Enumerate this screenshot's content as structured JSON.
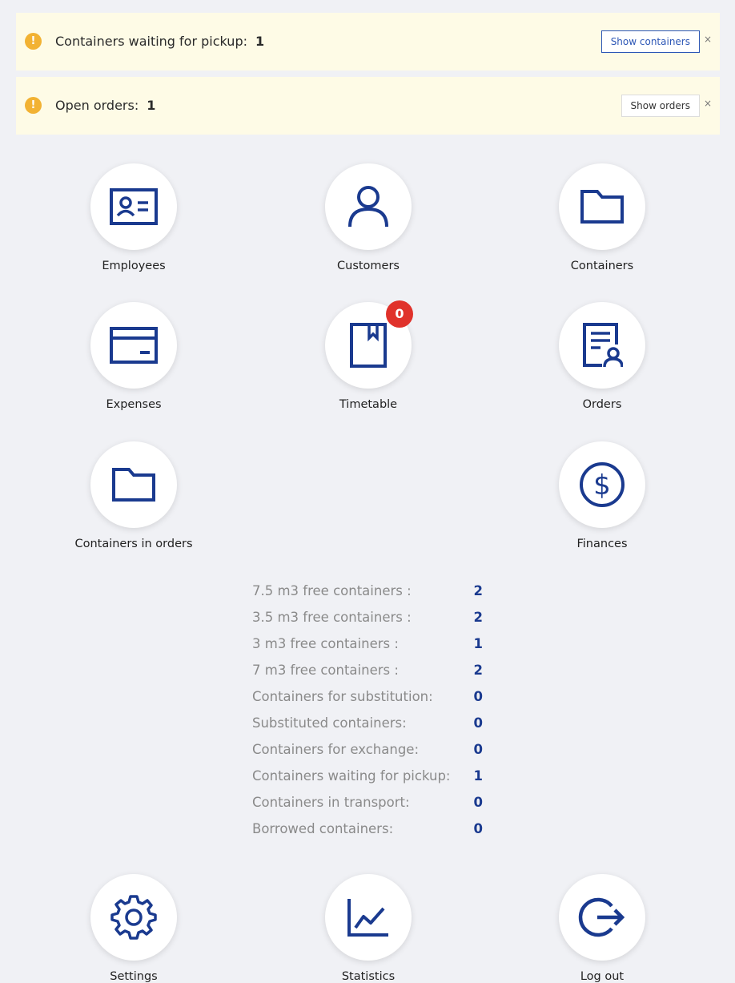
{
  "alerts": [
    {
      "label": "Containers waiting for pickup:",
      "count": "1",
      "button": "Show containers",
      "close": "×"
    },
    {
      "label": "Open orders:",
      "count": "1",
      "button": "Show orders",
      "close": "×"
    }
  ],
  "warn_symbol": "!",
  "tiles": {
    "employees": "Employees",
    "customers": "Customers",
    "containers": "Containers",
    "expenses": "Expenses",
    "timetable": "Timetable",
    "timetable_badge": "0",
    "orders": "Orders",
    "containers_in_orders": "Containers in orders",
    "finances": "Finances",
    "settings": "Settings",
    "statistics": "Statistics",
    "logout": "Log out"
  },
  "stats": [
    {
      "label": "7.5 m3 free containers :",
      "value": "2"
    },
    {
      "label": "3.5 m3 free containers :",
      "value": "2"
    },
    {
      "label": "3 m3 free containers :",
      "value": "1"
    },
    {
      "label": "7 m3 free containers :",
      "value": "2"
    },
    {
      "label": "Containers for substitution:",
      "value": "0"
    },
    {
      "label": "Substituted containers:",
      "value": "0"
    },
    {
      "label": "Containers for exchange:",
      "value": "0"
    },
    {
      "label": "Containers waiting for pickup:",
      "value": "1"
    },
    {
      "label": "Containers in transport:",
      "value": "0"
    },
    {
      "label": "Borrowed containers:",
      "value": "0"
    }
  ],
  "colors": {
    "icon": "#1a3a8f",
    "badge": "#e0322b",
    "alert_bg": "#fefbe6",
    "warn": "#f2b233",
    "page_bg": "#f0f1f5"
  }
}
